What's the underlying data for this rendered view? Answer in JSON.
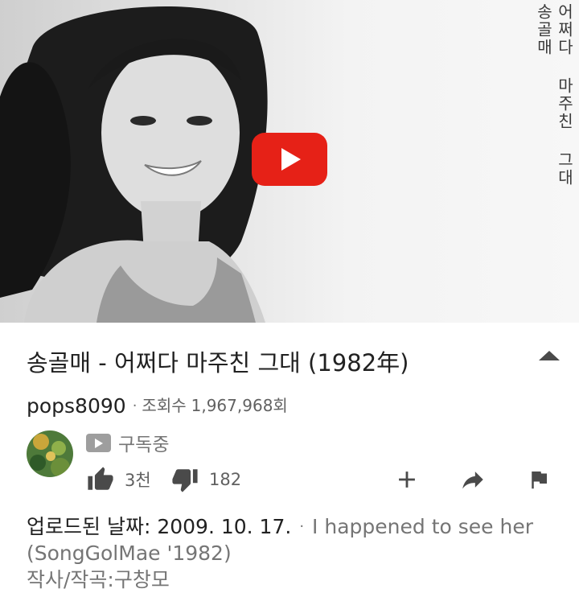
{
  "video": {
    "vertical_artist": "송골매",
    "vertical_title": "어쩌다 마주친 그대",
    "play_icon": "play-icon",
    "play_color": "#e62117"
  },
  "info": {
    "title": "송골매 - 어쩌다 마주친 그대 (1982年)",
    "collapse_icon": "chevron-up-icon",
    "channel": "pops8090",
    "separator": "·",
    "views_label": "조회수",
    "views_value": "1,967,968회"
  },
  "subscription": {
    "label": "구독중",
    "icon": "youtube-icon"
  },
  "actions": {
    "likes": "3천",
    "dislikes": "182",
    "like_icon": "thumbs-up-icon",
    "dislike_icon": "thumbs-down-icon",
    "add_icon": "plus-icon",
    "share_icon": "share-icon",
    "flag_icon": "flag-icon"
  },
  "description": {
    "date_label": "업로드된 날짜:",
    "date_value": "2009. 10. 17.",
    "separator": "·",
    "text_line1": "I happened to see her",
    "text_line2": "(SongGolMae '1982)",
    "text_line3": "작사/작곡:구창모"
  }
}
